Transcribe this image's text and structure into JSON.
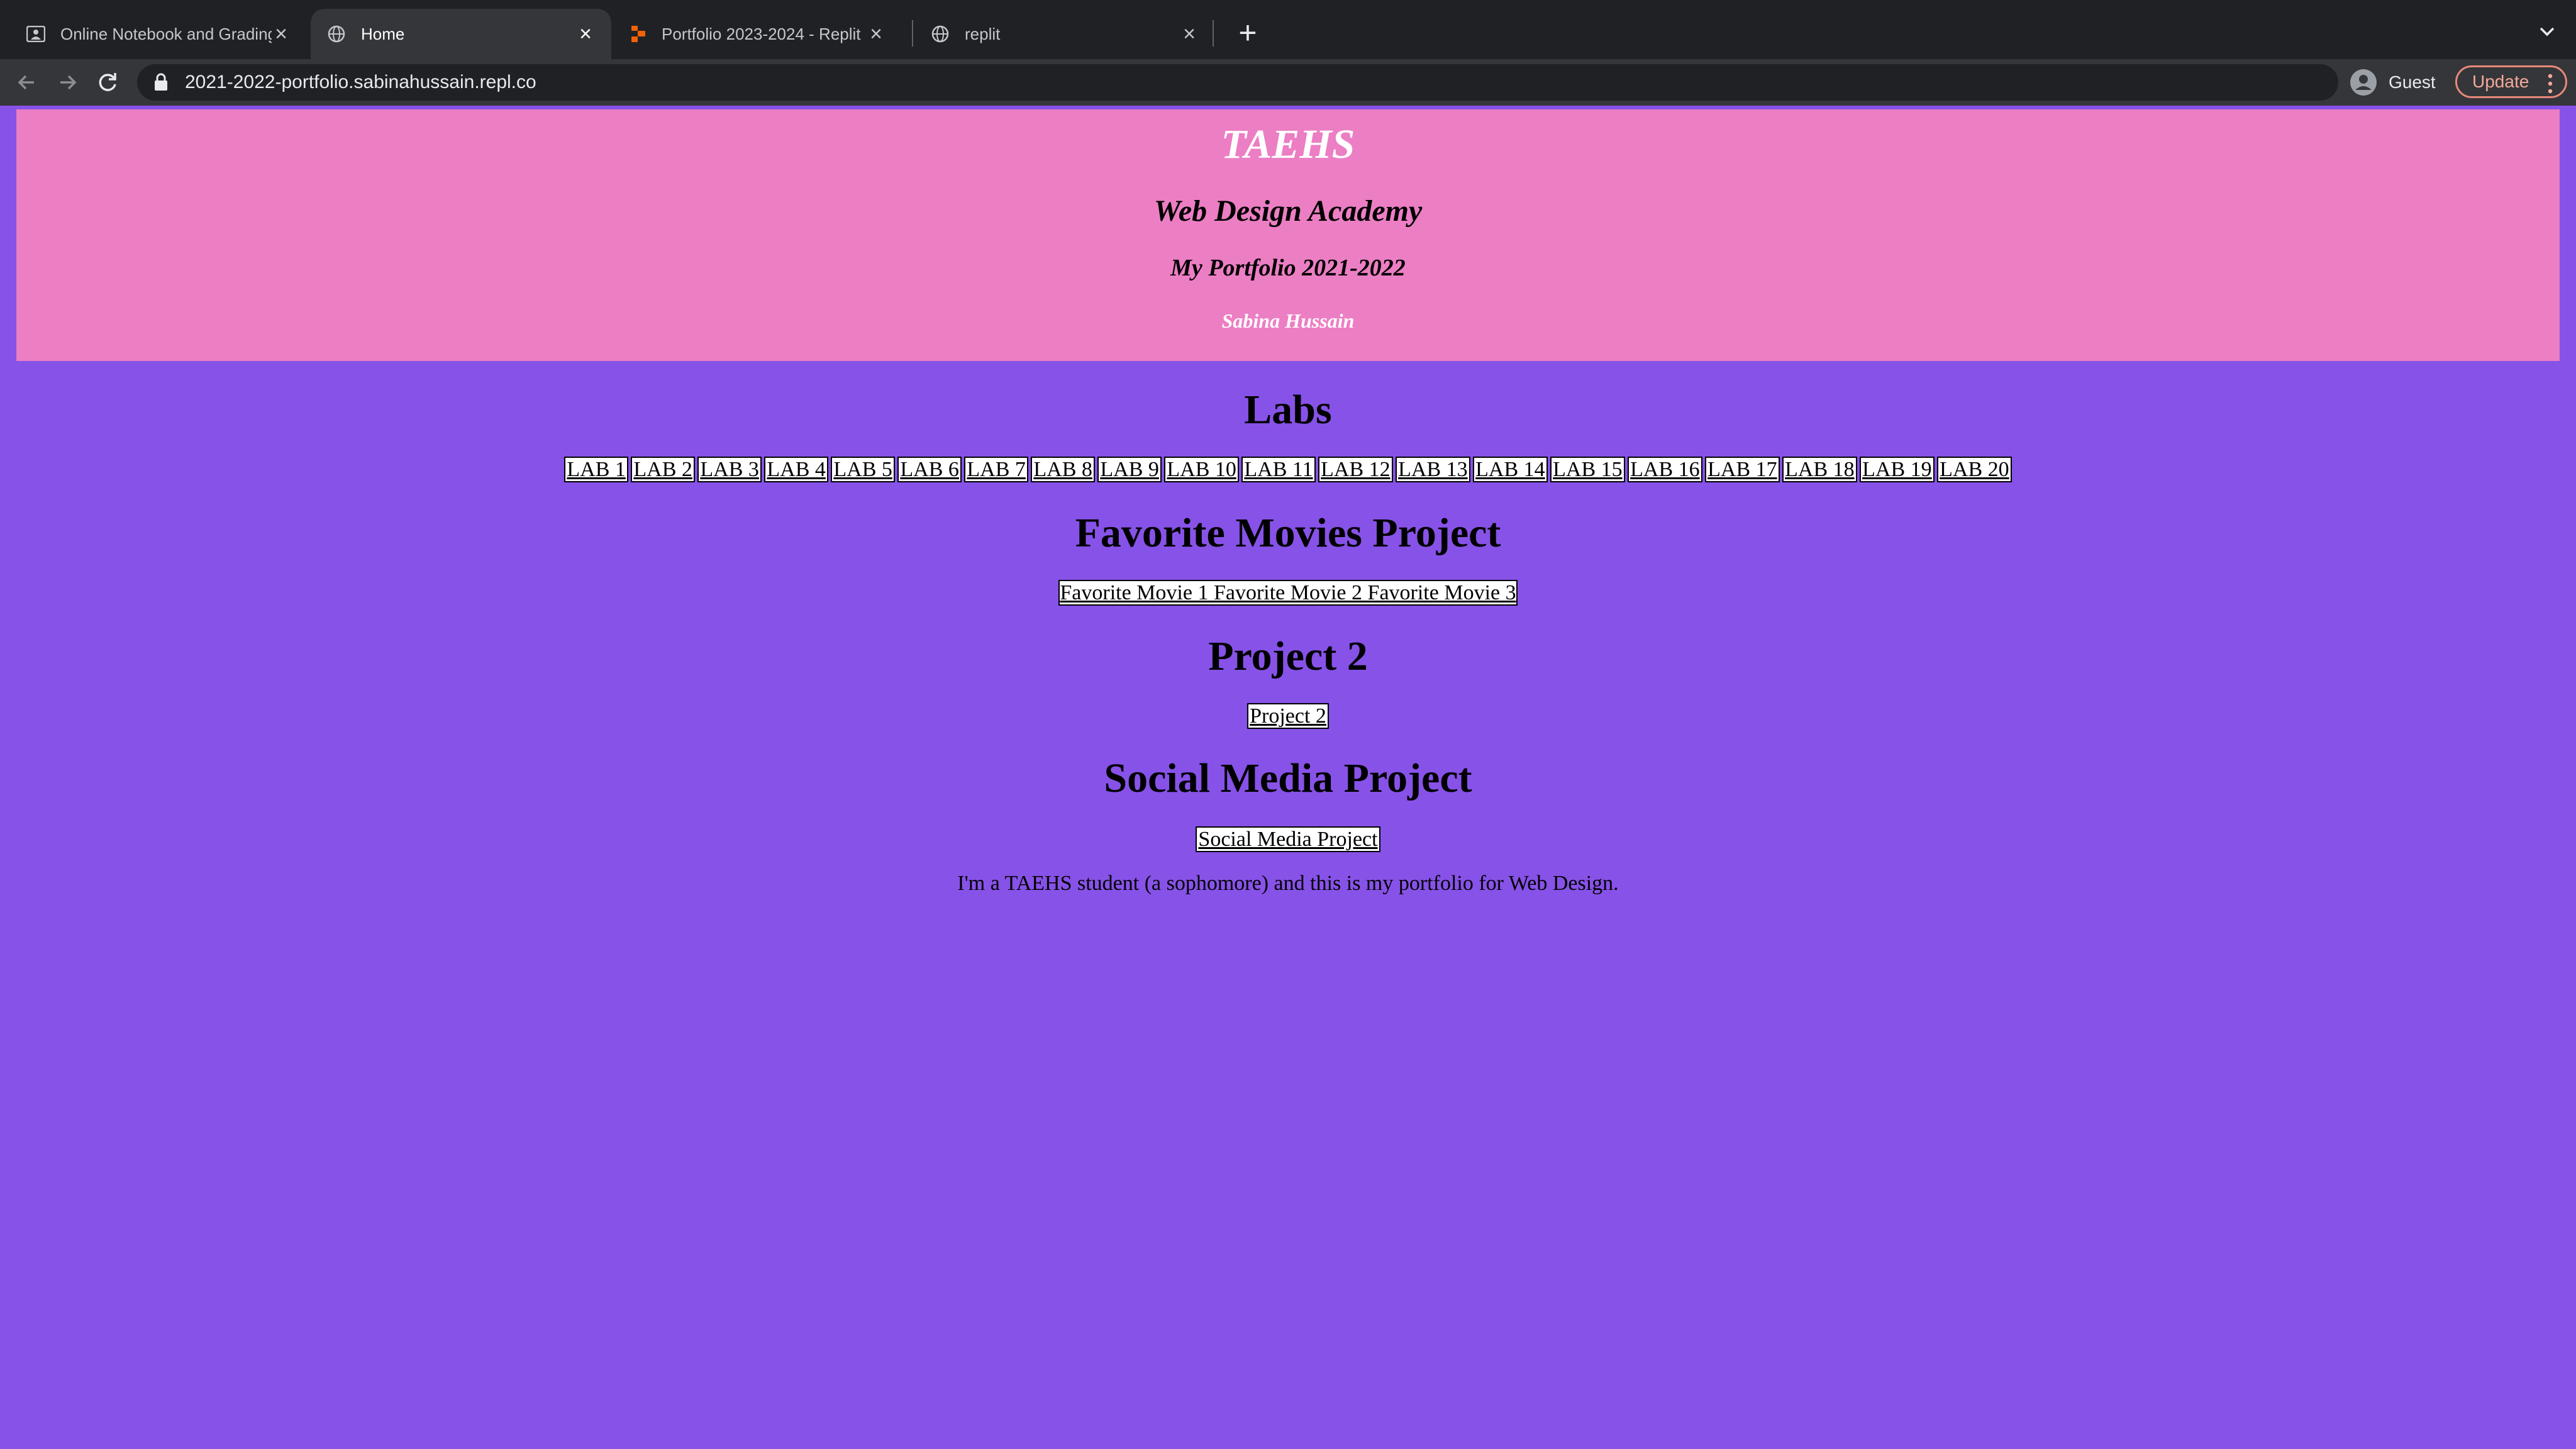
{
  "browser": {
    "tabs": [
      {
        "title": "Online Notebook and Grading C",
        "icon": "classroom-icon",
        "active": false
      },
      {
        "title": "Home",
        "icon": "globe-icon",
        "active": true
      },
      {
        "title": "Portfolio 2023-2024 - Replit",
        "icon": "replit-icon",
        "active": false
      },
      {
        "title": "replit",
        "icon": "globe-icon",
        "active": false
      }
    ],
    "url": "2021-2022-portfolio.sabinahussain.repl.co",
    "profile_label": "Guest",
    "update_label": "Update"
  },
  "header": {
    "school": "TAEHS",
    "academy": "Web Design Academy",
    "portfolio": "My Portfolio 2021-2022",
    "name": "Sabina Hussain"
  },
  "labs": {
    "title": "Labs",
    "links": [
      "LAB 1",
      "LAB 2",
      "LAB 3",
      "LAB 4",
      "LAB 5",
      "LAB 6",
      "LAB 7",
      "LAB 8",
      "LAB 9",
      "LAB 10",
      "LAB 11",
      "LAB 12",
      "LAB 13",
      "LAB 14",
      "LAB 15",
      "LAB 16",
      "LAB 17",
      "LAB 18",
      "LAB 19",
      "LAB 20"
    ]
  },
  "movies": {
    "title": "Favorite Movies Project",
    "links": [
      "Favorite Movie 1",
      "Favorite Movie 2",
      "Favorite Movie 3"
    ]
  },
  "project2": {
    "title": "Project 2",
    "link": "Project 2"
  },
  "social": {
    "title": "Social Media Project",
    "link": "Social Media Project"
  },
  "intro": "I'm a TAEHS student (a sophomore) and this is my portfolio for Web Design.",
  "colors": {
    "page_bg": "#8752e8",
    "header_bg": "#ec7ec4",
    "chrome_dark": "#202124",
    "chrome_toolbar": "#35363a"
  }
}
